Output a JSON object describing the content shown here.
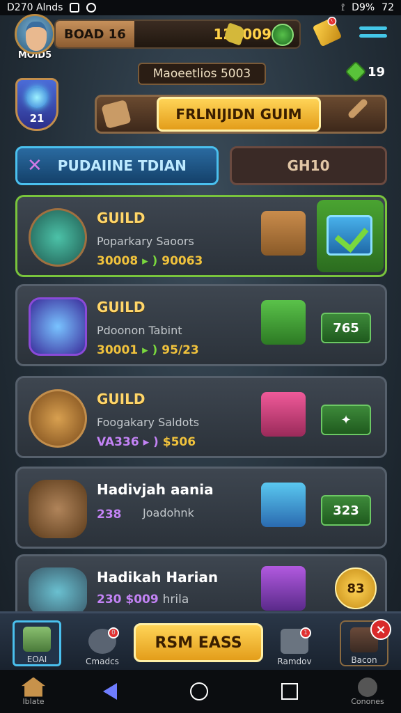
{
  "status_bar": {
    "time": "D270 Alnds",
    "battery": "D9%",
    "right_num": "72"
  },
  "hud": {
    "avatar_label": "MOlD5",
    "board_label": "BOAD 16",
    "gold_value": "120009",
    "alert_badge": "!",
    "gem_count": "19"
  },
  "title": "Maoeetlios 5003",
  "shield_level": "21",
  "banner": {
    "button_label": "FRLNIJIDN GUIM"
  },
  "tabs": {
    "left_label": "PUDAIINE TDIAN",
    "right_label": "GH10"
  },
  "cards": [
    {
      "title": "GUILD",
      "subtitle": "Poparkary Saoors",
      "stat_a": "30008",
      "stat_b": "90063",
      "action": "✔"
    },
    {
      "title": "GUILD",
      "subtitle": "Pdoonon Tabint",
      "stat_a": "30001",
      "stat_b": "95/23",
      "action": "765"
    },
    {
      "title": "GUILD",
      "subtitle": "Foogakary Saldots",
      "stat_a": "VA336",
      "stat_b": "$506",
      "action": "✦"
    },
    {
      "title": "Hadivjah aania",
      "subtitle": "Joadohnk",
      "stat_a": "238",
      "stat_b": "",
      "action": "323"
    },
    {
      "title": "Hadikah Harian",
      "subtitle": "hrila",
      "stat_a": "230 $009",
      "stat_b": "",
      "action": "83"
    }
  ],
  "bottom_nav": {
    "items": [
      "EOAI",
      "Cmadcs",
      "Ramdov",
      "Bacon"
    ],
    "main_button": "RSM EASS",
    "close": "×",
    "badges": [
      "0",
      "1"
    ]
  },
  "system_nav": {
    "left_label": "Iblate",
    "right_label": "Conones"
  },
  "colors": {
    "accent_gold": "#ffd457",
    "accent_blue": "#4ac0ee",
    "accent_green": "#79c43c"
  }
}
